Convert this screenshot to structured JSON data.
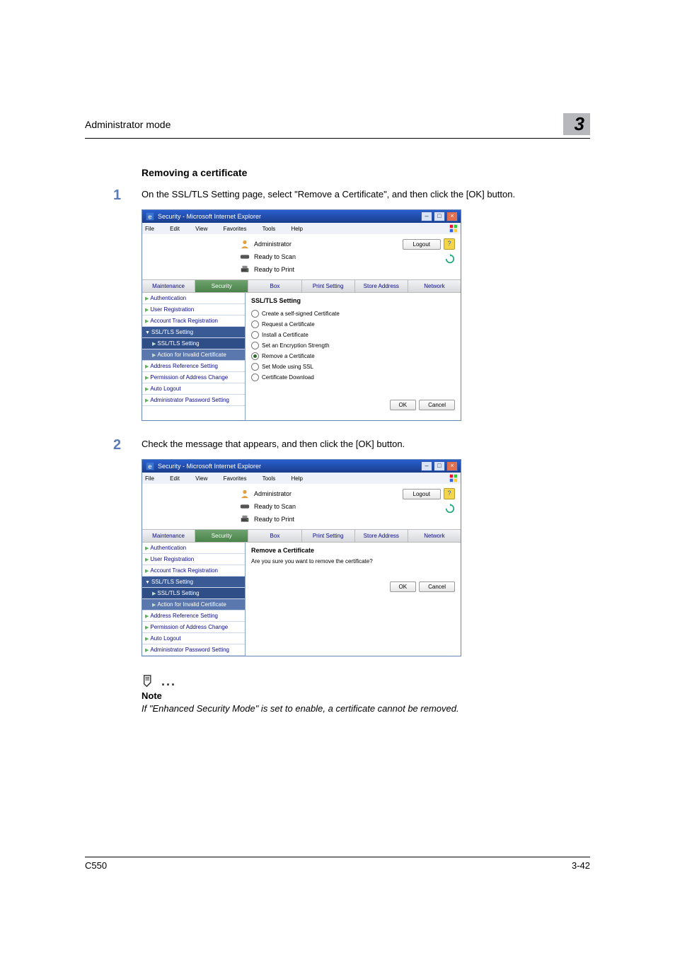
{
  "header": {
    "title": "Administrator mode",
    "chapter": "3"
  },
  "section": {
    "heading": "Removing a certificate"
  },
  "steps": [
    {
      "num": "1",
      "text": "On the SSL/TLS Setting page, select \"Remove a Certificate\", and then click the [OK] button."
    },
    {
      "num": "2",
      "text": "Check the message that appears, and then click the [OK] button."
    }
  ],
  "ie": {
    "title": "Security - Microsoft Internet Explorer",
    "menu": {
      "file": "File",
      "edit": "Edit",
      "view": "View",
      "favorites": "Favorites",
      "tools": "Tools",
      "help": "Help"
    }
  },
  "appHeader": {
    "role": "Administrator",
    "readyScan": "Ready to Scan",
    "readyPrint": "Ready to Print",
    "logout": "Logout"
  },
  "tabs": {
    "maintenance": "Maintenance",
    "security": "Security",
    "box": "Box",
    "printSetting": "Print Setting",
    "storeAddress": "Store Address",
    "network": "Network"
  },
  "sidebar": {
    "authentication": "Authentication",
    "userRegistration": "User Registration",
    "accountTrack": "Account Track Registration",
    "sslTls": "SSL/TLS Setting",
    "sslTlsSub": "SSL/TLS Setting",
    "actionInvalid": "Action for Invalid Certificate",
    "addressRef": "Address Reference Setting",
    "permAddrChange": "Permission of Address Change",
    "autoLogout": "Auto Logout",
    "adminPwd": "Administrator Password Setting"
  },
  "panel1": {
    "title": "SSL/TLS Setting",
    "opts": {
      "create": "Create a self-signed Certificate",
      "request": "Request a Certificate",
      "install": "Install a Certificate",
      "encStrength": "Set an Encryption Strength",
      "remove": "Remove a Certificate",
      "sslMode": "Set Mode using SSL",
      "download": "Certificate Download"
    }
  },
  "panel2": {
    "title": "Remove a Certificate",
    "msg": "Are you sure you want to remove the certificate?"
  },
  "buttons": {
    "ok": "OK",
    "cancel": "Cancel"
  },
  "note": {
    "label": "Note",
    "body": "If \"Enhanced Security Mode\" is set to enable, a certificate cannot be removed."
  },
  "footer": {
    "model": "C550",
    "page": "3-42"
  }
}
